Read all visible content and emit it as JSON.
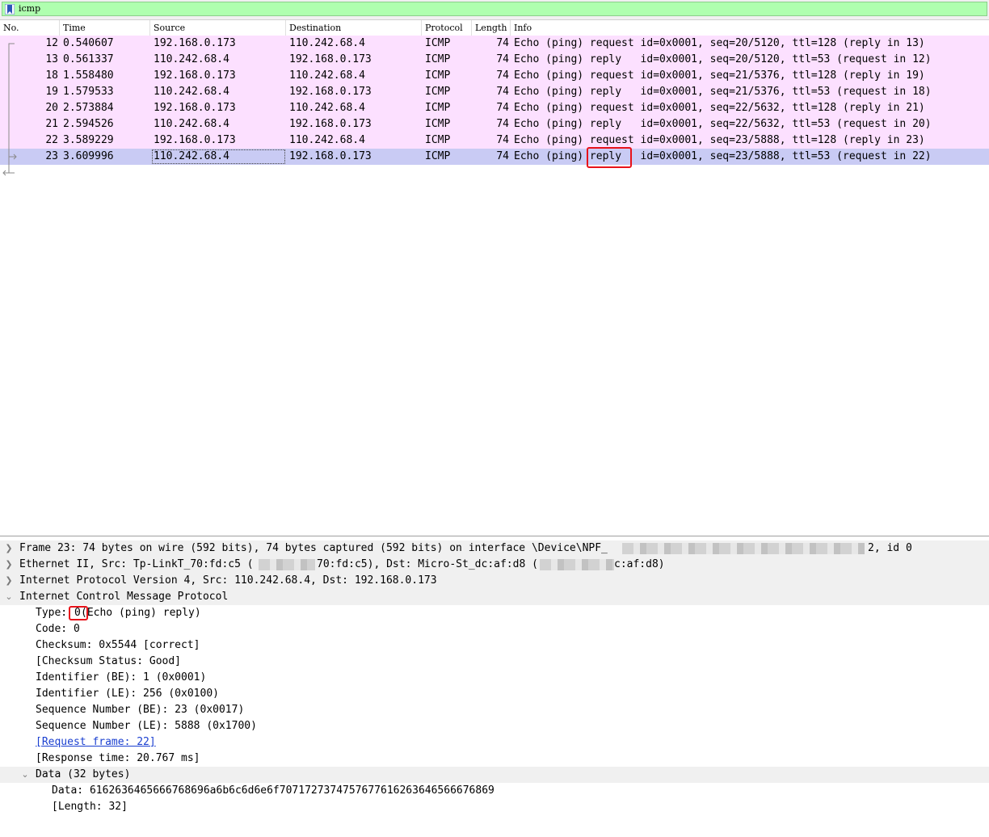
{
  "filter": {
    "text": "icmp",
    "bg_color": "#afffaf"
  },
  "columns": [
    "No.",
    "Time",
    "Source",
    "Destination",
    "Protocol",
    "Length",
    "Info"
  ],
  "packets": [
    {
      "no": "12",
      "time": "0.540607",
      "src": "192.168.0.173",
      "dst": "110.242.68.4",
      "proto": "ICMP",
      "len": "74",
      "info_a": "Echo (ping) ",
      "info_b": "request",
      "info_c": " id=0x0001, seq=20/5120, ttl=128 (reply in 13)"
    },
    {
      "no": "13",
      "time": "0.561337",
      "src": "110.242.68.4",
      "dst": "192.168.0.173",
      "proto": "ICMP",
      "len": "74",
      "info_a": "Echo (ping) ",
      "info_b": "reply",
      "info_c": "   id=0x0001, seq=20/5120, ttl=53 (request in 12)"
    },
    {
      "no": "18",
      "time": "1.558480",
      "src": "192.168.0.173",
      "dst": "110.242.68.4",
      "proto": "ICMP",
      "len": "74",
      "info_a": "Echo (ping) ",
      "info_b": "request",
      "info_c": " id=0x0001, seq=21/5376, ttl=128 (reply in 19)"
    },
    {
      "no": "19",
      "time": "1.579533",
      "src": "110.242.68.4",
      "dst": "192.168.0.173",
      "proto": "ICMP",
      "len": "74",
      "info_a": "Echo (ping) ",
      "info_b": "reply",
      "info_c": "   id=0x0001, seq=21/5376, ttl=53 (request in 18)"
    },
    {
      "no": "20",
      "time": "2.573884",
      "src": "192.168.0.173",
      "dst": "110.242.68.4",
      "proto": "ICMP",
      "len": "74",
      "info_a": "Echo (ping) ",
      "info_b": "request",
      "info_c": " id=0x0001, seq=22/5632, ttl=128 (reply in 21)"
    },
    {
      "no": "21",
      "time": "2.594526",
      "src": "110.242.68.4",
      "dst": "192.168.0.173",
      "proto": "ICMP",
      "len": "74",
      "info_a": "Echo (ping) ",
      "info_b": "reply",
      "info_c": "   id=0x0001, seq=22/5632, ttl=53 (request in 20)"
    },
    {
      "no": "22",
      "time": "3.589229",
      "src": "192.168.0.173",
      "dst": "110.242.68.4",
      "proto": "ICMP",
      "len": "74",
      "info_a": "Echo (ping) ",
      "info_b": "request",
      "info_c": " id=0x0001, seq=23/5888, ttl=128 (reply in 23)"
    },
    {
      "no": "23",
      "time": "3.609996",
      "src": "110.242.68.4",
      "dst": "192.168.0.173",
      "proto": "ICMP",
      "len": "74",
      "info_a": "Echo (ping) ",
      "info_b": "reply",
      "info_c": "   id=0x0001, seq=23/5888, ttl=53 (request in 22)"
    }
  ],
  "selected_packet": "23",
  "colors": {
    "row_bg": "#fce0ff",
    "selected_bg": "#c9cbf4",
    "highlight": "#e8121a",
    "link": "#1a3fd0"
  },
  "details": {
    "frame": {
      "a": "Frame 23: 74 bytes on wire (592 bits), 74 bytes captured (592 bits) on interface \\Device\\NPF_",
      "b": "2, id 0"
    },
    "ethernet": {
      "a": "Ethernet II, Src: Tp-LinkT_70:fd:c5 (",
      "b": "70:fd:c5), Dst: Micro-St_dc:af:d8 (",
      "c": "c:af:d8)"
    },
    "ip": "Internet Protocol Version 4, Src: 110.242.68.4, Dst: 192.168.0.173",
    "icmp": "Internet Control Message Protocol",
    "type_label": "Type: ",
    "type_value": "0",
    "type_desc": " (Echo (ping) reply)",
    "code": "Code: 0",
    "checksum": "Checksum: 0x5544 [correct]",
    "checksum_status": "[Checksum Status: Good]",
    "identifier_be": "Identifier (BE): 1 (0x0001)",
    "identifier_le": "Identifier (LE): 256 (0x0100)",
    "seq_be": "Sequence Number (BE): 23 (0x0017)",
    "seq_le": "Sequence Number (LE): 5888 (0x1700)",
    "request_frame": "[Request frame: 22]",
    "response_time": "[Response time: 20.767 ms]",
    "data_header": "Data (32 bytes)",
    "data_value": "Data: 6162636465666768696a6b6c6d6e6f7071727374757677616263646566676869",
    "data_length": "[Length: 32]"
  }
}
